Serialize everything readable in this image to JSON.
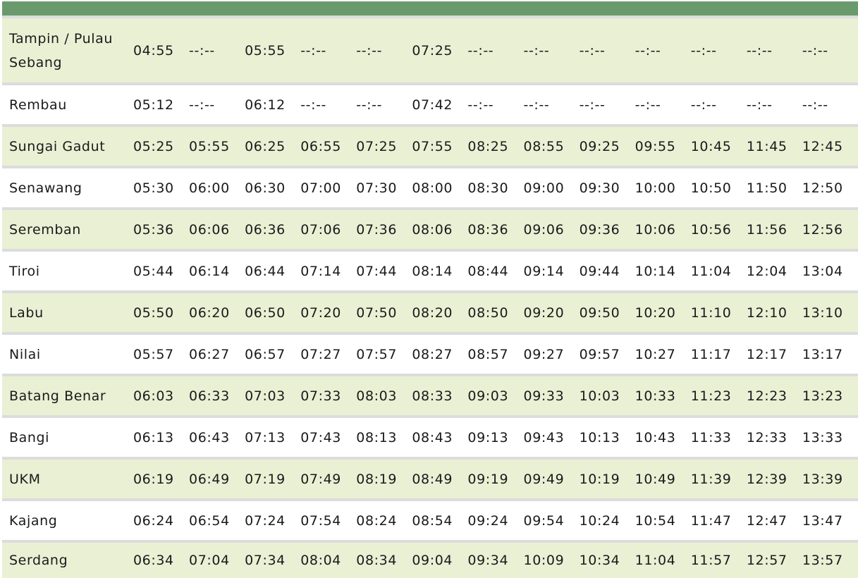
{
  "stations": [
    {
      "name": "Tampin / Pulau Sebang",
      "times": [
        "04:55",
        "--:--",
        "05:55",
        "--:--",
        "--:--",
        "07:25",
        "--:--",
        "--:--",
        "--:--",
        "--:--",
        "--:--",
        "--:--",
        "--:--"
      ]
    },
    {
      "name": "Rembau",
      "times": [
        "05:12",
        "--:--",
        "06:12",
        "--:--",
        "--:--",
        "07:42",
        "--:--",
        "--:--",
        "--:--",
        "--:--",
        "--:--",
        "--:--",
        "--:--"
      ]
    },
    {
      "name": "Sungai Gadut",
      "times": [
        "05:25",
        "05:55",
        "06:25",
        "06:55",
        "07:25",
        "07:55",
        "08:25",
        "08:55",
        "09:25",
        "09:55",
        "10:45",
        "11:45",
        "12:45"
      ]
    },
    {
      "name": "Senawang",
      "times": [
        "05:30",
        "06:00",
        "06:30",
        "07:00",
        "07:30",
        "08:00",
        "08:30",
        "09:00",
        "09:30",
        "10:00",
        "10:50",
        "11:50",
        "12:50"
      ]
    },
    {
      "name": "Seremban",
      "times": [
        "05:36",
        "06:06",
        "06:36",
        "07:06",
        "07:36",
        "08:06",
        "08:36",
        "09:06",
        "09:36",
        "10:06",
        "10:56",
        "11:56",
        "12:56"
      ]
    },
    {
      "name": "Tiroi",
      "times": [
        "05:44",
        "06:14",
        "06:44",
        "07:14",
        "07:44",
        "08:14",
        "08:44",
        "09:14",
        "09:44",
        "10:14",
        "11:04",
        "12:04",
        "13:04"
      ]
    },
    {
      "name": "Labu",
      "times": [
        "05:50",
        "06:20",
        "06:50",
        "07:20",
        "07:50",
        "08:20",
        "08:50",
        "09:20",
        "09:50",
        "10:20",
        "11:10",
        "12:10",
        "13:10"
      ]
    },
    {
      "name": "Nilai",
      "times": [
        "05:57",
        "06:27",
        "06:57",
        "07:27",
        "07:57",
        "08:27",
        "08:57",
        "09:27",
        "09:57",
        "10:27",
        "11:17",
        "12:17",
        "13:17"
      ]
    },
    {
      "name": "Batang Benar",
      "times": [
        "06:03",
        "06:33",
        "07:03",
        "07:33",
        "08:03",
        "08:33",
        "09:03",
        "09:33",
        "10:03",
        "10:33",
        "11:23",
        "12:23",
        "13:23"
      ]
    },
    {
      "name": "Bangi",
      "times": [
        "06:13",
        "06:43",
        "07:13",
        "07:43",
        "08:13",
        "08:43",
        "09:13",
        "09:43",
        "10:13",
        "10:43",
        "11:33",
        "12:33",
        "13:33"
      ]
    },
    {
      "name": "UKM",
      "times": [
        "06:19",
        "06:49",
        "07:19",
        "07:49",
        "08:19",
        "08:49",
        "09:19",
        "09:49",
        "10:19",
        "10:49",
        "11:39",
        "12:39",
        "13:39"
      ]
    },
    {
      "name": "Kajang",
      "times": [
        "06:24",
        "06:54",
        "07:24",
        "07:54",
        "08:24",
        "08:54",
        "09:24",
        "09:54",
        "10:24",
        "10:54",
        "11:47",
        "12:47",
        "13:47"
      ]
    },
    {
      "name": "Serdang",
      "times": [
        "06:34",
        "07:04",
        "07:34",
        "08:04",
        "08:34",
        "09:04",
        "09:34",
        "10:09",
        "10:34",
        "11:04",
        "11:57",
        "12:57",
        "13:57"
      ]
    }
  ],
  "colors": {
    "header": "#6a9a6c",
    "row_alt": "#eaf0d4",
    "row_plain": "#ffffff",
    "separator": "#dcdcdc"
  }
}
